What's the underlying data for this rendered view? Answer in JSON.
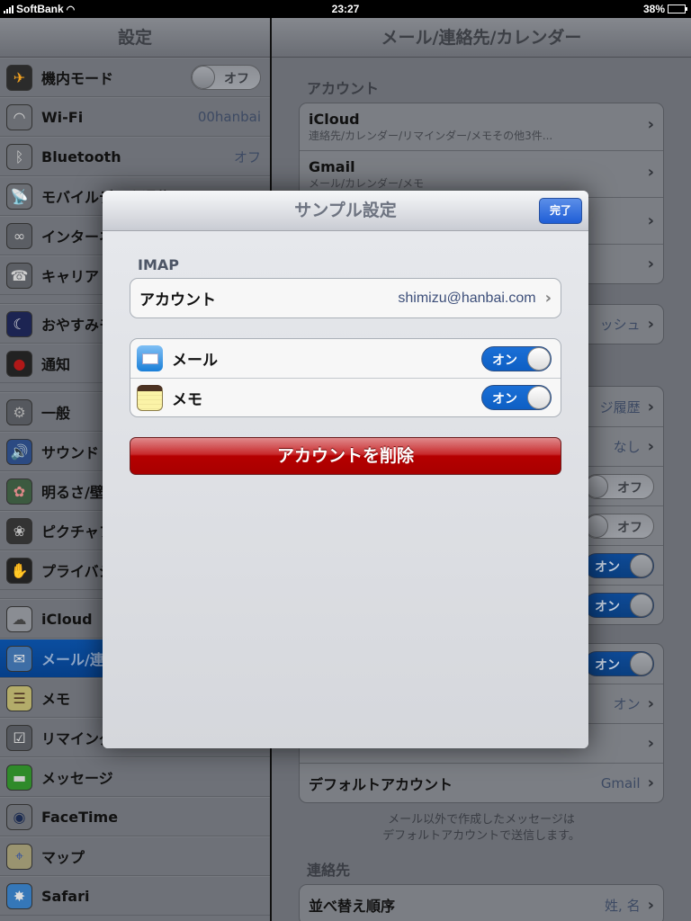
{
  "status_bar": {
    "carrier": "SoftBank",
    "time": "23:27",
    "battery": "38%",
    "battery_level": 0.38
  },
  "sidebar": {
    "title": "設定",
    "items": [
      {
        "label": "機内モード",
        "icon": "airplane-icon",
        "toggle": "オフ"
      },
      {
        "label": "Wi-Fi",
        "icon": "wifi-icon",
        "value": "00hanbai"
      },
      {
        "label": "Bluetooth",
        "icon": "bluetooth-icon",
        "value": "オフ"
      },
      {
        "label": "モバイルデータ通信",
        "icon": "cellular-icon"
      },
      {
        "label": "インターネット共有",
        "icon": "personal-hotspot-icon"
      },
      {
        "label": "キャリア",
        "icon": "carrier-phone-icon"
      },
      {
        "label": "おやすみモード",
        "icon": "moon-icon"
      },
      {
        "label": "通知",
        "icon": "notifications-icon"
      },
      {
        "label": "一般",
        "icon": "gear-icon"
      },
      {
        "label": "サウンド",
        "icon": "sound-icon"
      },
      {
        "label": "明るさ/壁紙",
        "icon": "wallpaper-icon"
      },
      {
        "label": "ピクチャフレーム",
        "icon": "picture-frame-icon"
      },
      {
        "label": "プライバシー",
        "icon": "hand-icon"
      },
      {
        "label": "iCloud",
        "icon": "cloud-icon"
      },
      {
        "label": "メール/連絡先/カレンダー",
        "icon": "mail-icon",
        "selected": true
      },
      {
        "label": "メモ",
        "icon": "notes-icon"
      },
      {
        "label": "リマインダー",
        "icon": "reminders-icon"
      },
      {
        "label": "メッセージ",
        "icon": "messages-icon"
      },
      {
        "label": "FaceTime",
        "icon": "facetime-icon"
      },
      {
        "label": "マップ",
        "icon": "maps-icon"
      },
      {
        "label": "Safari",
        "icon": "safari-icon"
      }
    ]
  },
  "detail": {
    "title": "メール/連絡先/カレンダー",
    "accounts_header": "アカウント",
    "accounts": [
      {
        "name": "iCloud",
        "sub": "連絡先/カレンダー/リマインダー/メモその他3件..."
      },
      {
        "name": "Gmail",
        "sub": "メール/カレンダー/メモ"
      },
      {
        "name": ""
      },
      {
        "name": ""
      }
    ],
    "fetch_value": "ッシュ",
    "mail_rows": [
      {
        "value": "ジ履歴",
        "type": "chevron"
      },
      {
        "value": "なし",
        "type": "chevron"
      },
      {
        "toggle": "オフ",
        "type": "toggle-off"
      },
      {
        "toggle": "オフ",
        "type": "toggle-off"
      },
      {
        "toggle": "オン",
        "type": "toggle-on"
      },
      {
        "toggle": "オン",
        "type": "toggle-on"
      }
    ],
    "mail_rows2": [
      {
        "toggle": "オン",
        "type": "toggle-on"
      },
      {
        "value": "オン",
        "type": "chevron"
      },
      {
        "value": "",
        "type": "chevron"
      },
      {
        "title": "デフォルトアカウント",
        "value": "Gmail",
        "type": "chevron"
      }
    ],
    "default_note_line1": "メール以外で作成したメッセージは",
    "default_note_line2": "デフォルトアカウントで送信します。",
    "contacts_header": "連絡先",
    "sort_order_label": "並べ替え順序",
    "sort_order_value": "姓, 名"
  },
  "modal": {
    "title": "サンプル設定",
    "done_label": "完了",
    "section_header": "IMAP",
    "account_label": "アカウント",
    "account_value": "shimizu@hanbai.com",
    "services": [
      {
        "label": "メール",
        "icon": "mail-icon",
        "toggle": "オン",
        "on": true
      },
      {
        "label": "メモ",
        "icon": "notes-icon",
        "toggle": "オン",
        "on": true
      }
    ],
    "delete_label": "アカウントを削除"
  },
  "colors": {
    "delete_red": "#b50000",
    "toggle_blue": "#1a6fd6",
    "done_blue": "#1f5ed6"
  }
}
